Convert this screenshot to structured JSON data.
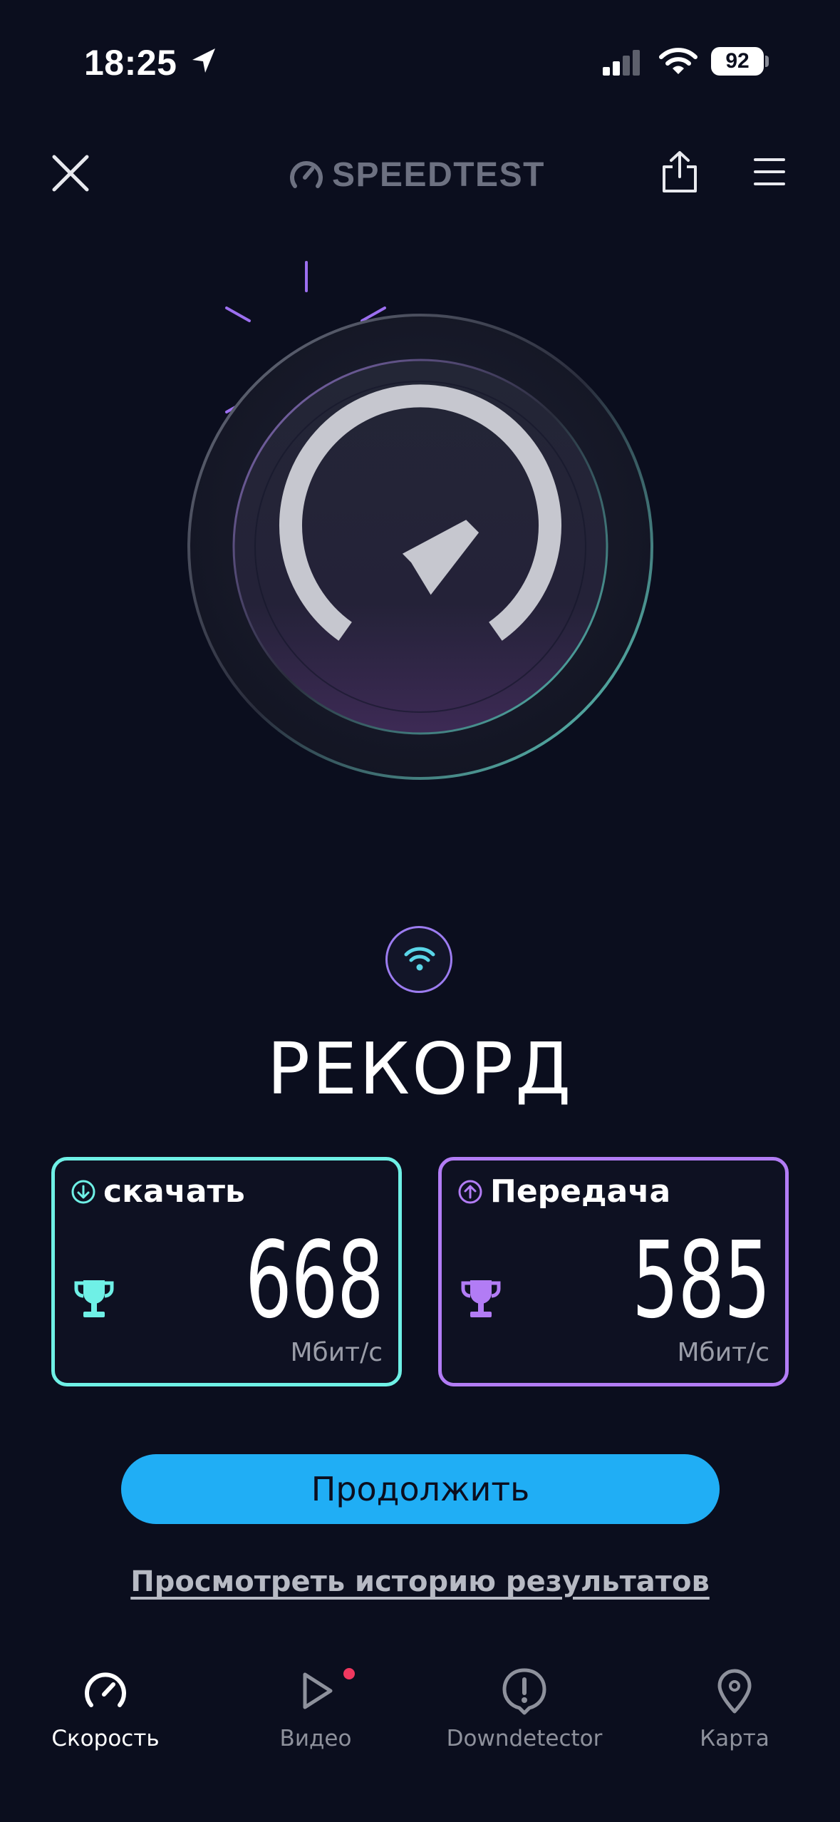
{
  "status_bar": {
    "time": "18:25",
    "battery": "92",
    "icons": [
      "location-arrow-icon",
      "cellular-signal-icon",
      "wifi-icon",
      "battery-icon"
    ]
  },
  "header": {
    "brand": "SPEEDTEST",
    "icons": [
      "close-icon",
      "speedtest-logo-icon",
      "share-icon",
      "menu-icon"
    ]
  },
  "connection": {
    "icon": "wifi-icon",
    "title": "РЕКОРД"
  },
  "results": {
    "download": {
      "label": "скачать",
      "value": "668",
      "unit": "Мбит/с",
      "icon": "download-arrow-icon",
      "color": "#6ff0e6"
    },
    "upload": {
      "label": "Передача",
      "value": "585",
      "unit": "Мбит/с",
      "icon": "upload-arrow-icon",
      "color": "#b27cf5"
    }
  },
  "actions": {
    "continue_label": "Продолжить",
    "history_label": "Просмотреть историю результатов"
  },
  "tabs": [
    {
      "label": "Скорость",
      "icon": "speedometer-icon",
      "active": true
    },
    {
      "label": "Видео",
      "icon": "play-icon",
      "active": false,
      "badge": true
    },
    {
      "label": "Downdetector",
      "icon": "alert-icon",
      "active": false
    },
    {
      "label": "Карта",
      "icon": "map-pin-icon",
      "active": false
    }
  ],
  "colors": {
    "background": "#0b0e1e",
    "accent_blue": "#20aef5",
    "download": "#6ff0e6",
    "upload": "#b27cf5",
    "badge": "#f0385f"
  }
}
